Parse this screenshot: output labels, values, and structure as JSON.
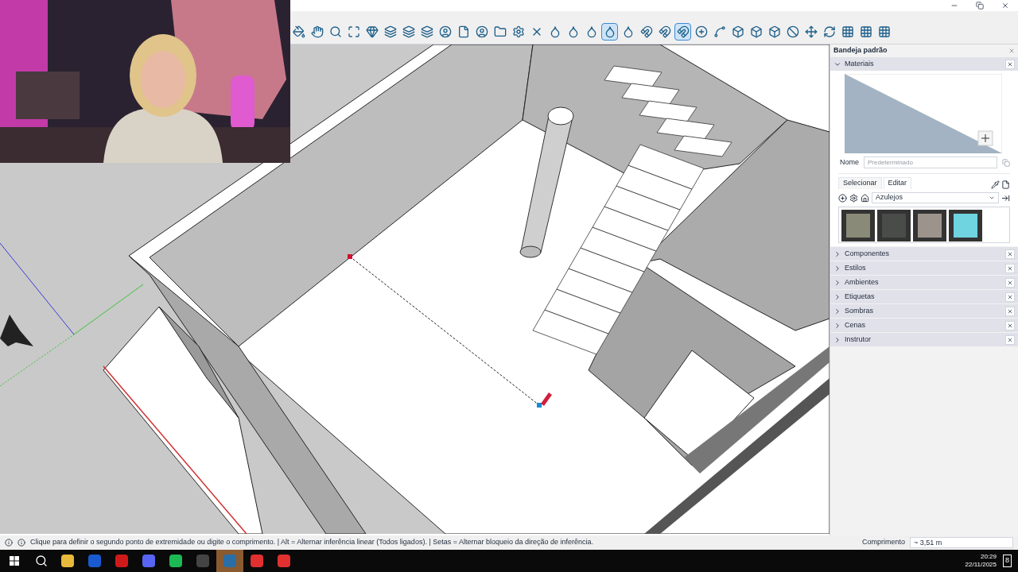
{
  "window": {
    "controls": [
      {
        "kind": "minimize"
      },
      {
        "kind": "restore"
      },
      {
        "kind": "close"
      }
    ]
  },
  "toolbar": {
    "tools": [
      {
        "kind": "paint",
        "selected": false
      },
      {
        "kind": "hand",
        "selected": false
      },
      {
        "kind": "zoom",
        "selected": false
      },
      {
        "kind": "extents",
        "selected": false
      },
      {
        "kind": "gem",
        "selected": false
      },
      {
        "kind": "layers",
        "selected": false
      },
      {
        "kind": "stack",
        "selected": false
      },
      {
        "kind": "layers",
        "selected": false
      },
      {
        "kind": "user",
        "selected": false
      },
      {
        "kind": "file",
        "selected": false
      },
      {
        "kind": "user",
        "selected": false
      },
      {
        "kind": "folder",
        "selected": false
      },
      {
        "kind": "gear",
        "selected": false
      },
      {
        "kind": "x",
        "selected": false
      },
      {
        "kind": "drop",
        "selected": false
      },
      {
        "kind": "drop",
        "selected": false
      },
      {
        "kind": "drop",
        "selected": false
      },
      {
        "kind": "drop",
        "selected": true
      },
      {
        "kind": "drop",
        "selected": false
      },
      {
        "kind": "magnet",
        "selected": false
      },
      {
        "kind": "magnet",
        "selected": false
      },
      {
        "kind": "magnet",
        "selected": true
      },
      {
        "kind": "plus",
        "selected": false
      },
      {
        "kind": "line",
        "selected": false
      },
      {
        "kind": "box",
        "selected": false
      },
      {
        "kind": "box",
        "selected": false
      },
      {
        "kind": "box",
        "selected": false
      },
      {
        "kind": "ban",
        "selected": false
      },
      {
        "kind": "move",
        "selected": false
      },
      {
        "kind": "refresh",
        "selected": false
      },
      {
        "kind": "grid",
        "selected": false
      },
      {
        "kind": "grid",
        "selected": false
      },
      {
        "kind": "grid",
        "selected": false
      }
    ]
  },
  "tray": {
    "title": "Bandeja padrão",
    "materials": {
      "title": "Materiais",
      "expanded": true,
      "name_label": "Nome",
      "name_placeholder": "Predeterminado",
      "tabs": [
        {
          "label": "Selecionar",
          "selected": true
        },
        {
          "label": "Editar",
          "selected": false
        }
      ],
      "library": "Azulejos",
      "swatches": [
        {
          "color": "#8a8a78"
        },
        {
          "color": "#4a4c4a"
        },
        {
          "color": "#9c948c"
        },
        {
          "color": "#6fd3e0"
        }
      ]
    },
    "sections": [
      {
        "title": "Componentes",
        "expanded": false
      },
      {
        "title": "Estilos",
        "expanded": false
      },
      {
        "title": "Ambientes",
        "expanded": false
      },
      {
        "title": "Etiquetas",
        "expanded": false
      },
      {
        "title": "Sombras",
        "expanded": false
      },
      {
        "title": "Cenas",
        "expanded": false
      },
      {
        "title": "Instrutor",
        "expanded": false
      }
    ]
  },
  "status_bar": {
    "message": "Clique para definir o segundo ponto de extremidade ou digite o comprimento. | Alt = Alternar inferência linear (Todos ligados). | Setas = Alternar bloqueio da direção de inferência.",
    "measure_label": "Comprimento",
    "measure_value": "~ 3,51 m"
  },
  "taskbar": {
    "apps": [
      {
        "kind": "folder",
        "selected": false
      },
      {
        "kind": "a",
        "selected": false
      },
      {
        "kind": "opera",
        "selected": false
      },
      {
        "kind": "discord",
        "selected": false
      },
      {
        "kind": "spotify",
        "selected": false
      },
      {
        "kind": "obs",
        "selected": false
      },
      {
        "kind": "sketchup",
        "selected": true
      },
      {
        "kind": "anydesk",
        "selected": false
      },
      {
        "kind": "anydesk",
        "selected": false
      }
    ],
    "time": "20:29",
    "date": "22/11/2025",
    "notifications": "8"
  }
}
